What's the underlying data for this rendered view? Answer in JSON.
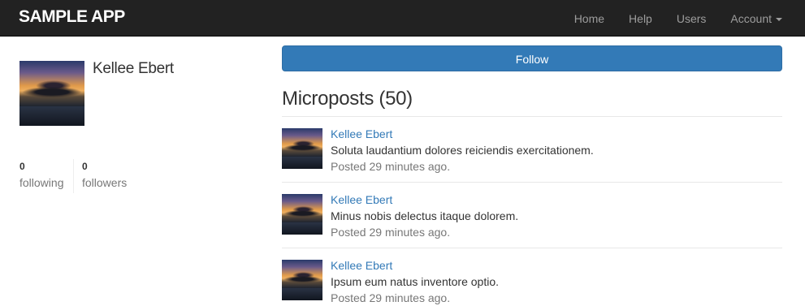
{
  "navbar": {
    "brand": "SAMPLE APP",
    "links": [
      "Home",
      "Help",
      "Users",
      "Account"
    ]
  },
  "profile": {
    "name": "Kellee Ebert",
    "following_count": "0",
    "following_label": "following",
    "followers_count": "0",
    "followers_label": "followers"
  },
  "follow_button": "Follow",
  "microposts": {
    "title": "Microposts (50)",
    "items": [
      {
        "author": "Kellee Ebert",
        "content": "Soluta laudantium dolores reiciendis exercitationem.",
        "timestamp": "Posted 29 minutes ago."
      },
      {
        "author": "Kellee Ebert",
        "content": "Minus nobis delectus itaque dolorem.",
        "timestamp": "Posted 29 minutes ago."
      },
      {
        "author": "Kellee Ebert",
        "content": "Ipsum eum natus inventore optio.",
        "timestamp": "Posted 29 minutes ago."
      }
    ]
  },
  "colors": {
    "navbar_bg": "#222222",
    "link": "#337ab7",
    "button": "#337ab7"
  }
}
